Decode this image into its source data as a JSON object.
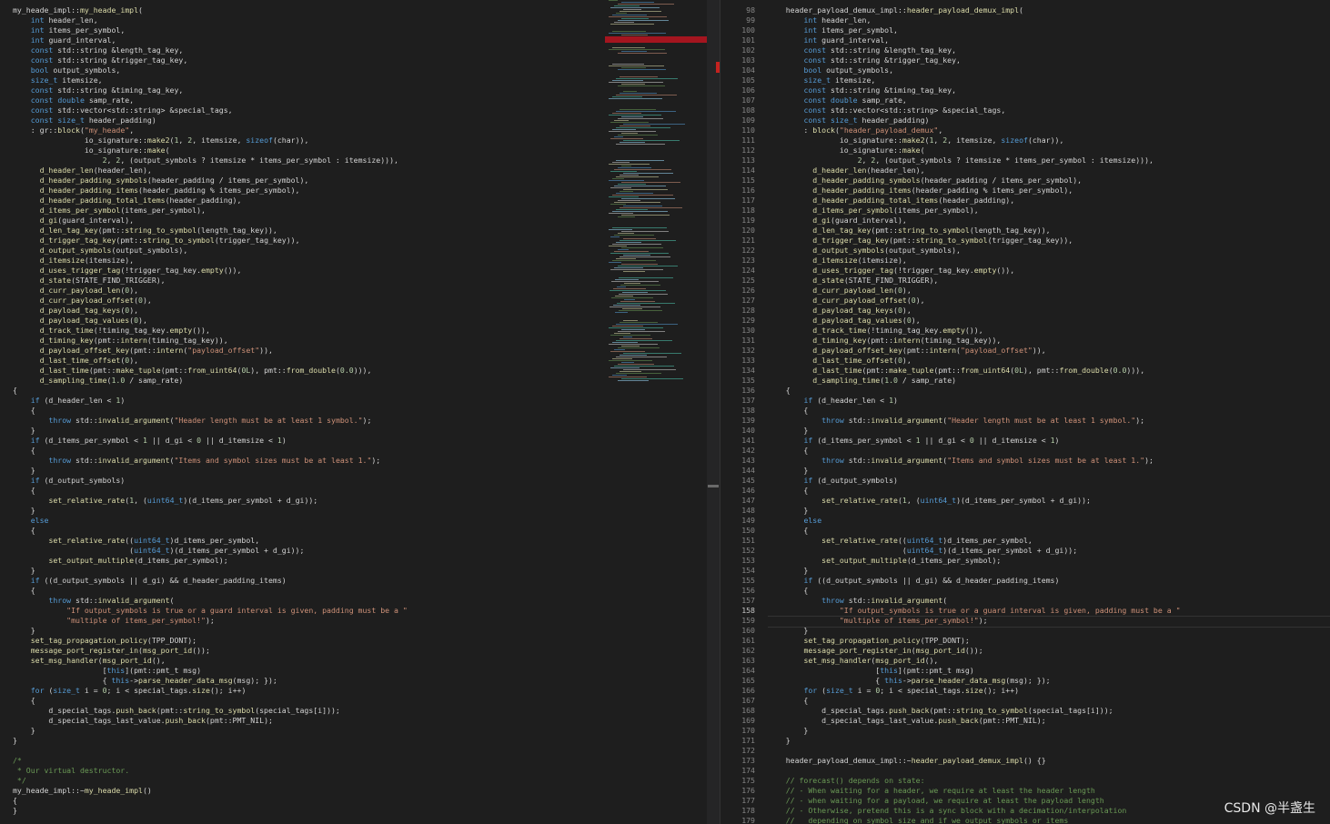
{
  "watermark": "CSDN @半盏生",
  "editor": {
    "active_line": 158,
    "right_start_line": 98
  },
  "left_code": [
    "my_heade_impl::my_heade_impl(",
    "    int header_len,",
    "    int items_per_symbol,",
    "    int guard_interval,",
    "    const std::string &length_tag_key,",
    "    const std::string &trigger_tag_key,",
    "    bool output_symbols,",
    "    size_t itemsize,",
    "    const std::string &timing_tag_key,",
    "    const double samp_rate,",
    "    const std::vector<std::string> &special_tags,",
    "    const size_t header_padding)",
    "    : gr::block(\"my_heade\",",
    "                io_signature::make2(1, 2, itemsize, sizeof(char)),",
    "                io_signature::make(",
    "                    2, 2, (output_symbols ? itemsize * items_per_symbol : itemsize))),",
    "      d_header_len(header_len),",
    "      d_header_padding_symbols(header_padding / items_per_symbol),",
    "      d_header_padding_items(header_padding % items_per_symbol),",
    "      d_header_padding_total_items(header_padding),",
    "      d_items_per_symbol(items_per_symbol),",
    "      d_gi(guard_interval),",
    "      d_len_tag_key(pmt::string_to_symbol(length_tag_key)),",
    "      d_trigger_tag_key(pmt::string_to_symbol(trigger_tag_key)),",
    "      d_output_symbols(output_symbols),",
    "      d_itemsize(itemsize),",
    "      d_uses_trigger_tag(!trigger_tag_key.empty()),",
    "      d_state(STATE_FIND_TRIGGER),",
    "      d_curr_payload_len(0),",
    "      d_curr_payload_offset(0),",
    "      d_payload_tag_keys(0),",
    "      d_payload_tag_values(0),",
    "      d_track_time(!timing_tag_key.empty()),",
    "      d_timing_key(pmt::intern(timing_tag_key)),",
    "      d_payload_offset_key(pmt::intern(\"payload_offset\")),",
    "      d_last_time_offset(0),",
    "      d_last_time(pmt::make_tuple(pmt::from_uint64(0L), pmt::from_double(0.0))),",
    "      d_sampling_time(1.0 / samp_rate)",
    "{",
    "    if (d_header_len < 1)",
    "    {",
    "        throw std::invalid_argument(\"Header length must be at least 1 symbol.\");",
    "    }",
    "    if (d_items_per_symbol < 1 || d_gi < 0 || d_itemsize < 1)",
    "    {",
    "        throw std::invalid_argument(\"Items and symbol sizes must be at least 1.\");",
    "    }",
    "    if (d_output_symbols)",
    "    {",
    "        set_relative_rate(1, (uint64_t)(d_items_per_symbol + d_gi));",
    "    }",
    "    else",
    "    {",
    "        set_relative_rate((uint64_t)d_items_per_symbol,",
    "                          (uint64_t)(d_items_per_symbol + d_gi));",
    "        set_output_multiple(d_items_per_symbol);",
    "    }",
    "    if ((d_output_symbols || d_gi) && d_header_padding_items)",
    "    {",
    "        throw std::invalid_argument(",
    "            \"If output_symbols is true or a guard interval is given, padding must be a \"",
    "            \"multiple of items_per_symbol!\");",
    "    }",
    "    set_tag_propagation_policy(TPP_DONT);",
    "    message_port_register_in(msg_port_id());",
    "    set_msg_handler(msg_port_id(),",
    "                    [this](pmt::pmt_t msg)",
    "                    { this->parse_header_data_msg(msg); });",
    "    for (size_t i = 0; i < special_tags.size(); i++)",
    "    {",
    "        d_special_tags.push_back(pmt::string_to_symbol(special_tags[i]));",
    "        d_special_tags_last_value.push_back(pmt::PMT_NIL);",
    "    }",
    "}",
    "",
    "/*",
    " * Our virtual destructor.",
    " */",
    "my_heade_impl::~my_heade_impl()",
    "{",
    "}"
  ],
  "right_code": [
    "    header_payload_demux_impl::header_payload_demux_impl(",
    "        int header_len,",
    "        int items_per_symbol,",
    "        int guard_interval,",
    "        const std::string &length_tag_key,",
    "        const std::string &trigger_tag_key,",
    "        bool output_symbols,",
    "        size_t itemsize,",
    "        const std::string &timing_tag_key,",
    "        const double samp_rate,",
    "        const std::vector<std::string> &special_tags,",
    "        const size_t header_padding)",
    "        : block(\"header_payload_demux\",",
    "                io_signature::make2(1, 2, itemsize, sizeof(char)),",
    "                io_signature::make(",
    "                    2, 2, (output_symbols ? itemsize * items_per_symbol : itemsize))),",
    "          d_header_len(header_len),",
    "          d_header_padding_symbols(header_padding / items_per_symbol),",
    "          d_header_padding_items(header_padding % items_per_symbol),",
    "          d_header_padding_total_items(header_padding),",
    "          d_items_per_symbol(items_per_symbol),",
    "          d_gi(guard_interval),",
    "          d_len_tag_key(pmt::string_to_symbol(length_tag_key)),",
    "          d_trigger_tag_key(pmt::string_to_symbol(trigger_tag_key)),",
    "          d_output_symbols(output_symbols),",
    "          d_itemsize(itemsize),",
    "          d_uses_trigger_tag(!trigger_tag_key.empty()),",
    "          d_state(STATE_FIND_TRIGGER),",
    "          d_curr_payload_len(0),",
    "          d_curr_payload_offset(0),",
    "          d_payload_tag_keys(0),",
    "          d_payload_tag_values(0),",
    "          d_track_time(!timing_tag_key.empty()),",
    "          d_timing_key(pmt::intern(timing_tag_key)),",
    "          d_payload_offset_key(pmt::intern(\"payload_offset\")),",
    "          d_last_time_offset(0),",
    "          d_last_time(pmt::make_tuple(pmt::from_uint64(0L), pmt::from_double(0.0))),",
    "          d_sampling_time(1.0 / samp_rate)",
    "    {",
    "        if (d_header_len < 1)",
    "        {",
    "            throw std::invalid_argument(\"Header length must be at least 1 symbol.\");",
    "        }",
    "        if (d_items_per_symbol < 1 || d_gi < 0 || d_itemsize < 1)",
    "        {",
    "            throw std::invalid_argument(\"Items and symbol sizes must be at least 1.\");",
    "        }",
    "        if (d_output_symbols)",
    "        {",
    "            set_relative_rate(1, (uint64_t)(d_items_per_symbol + d_gi));",
    "        }",
    "        else",
    "        {",
    "            set_relative_rate((uint64_t)d_items_per_symbol,",
    "                              (uint64_t)(d_items_per_symbol + d_gi));",
    "            set_output_multiple(d_items_per_symbol);",
    "        }",
    "        if ((d_output_symbols || d_gi) && d_header_padding_items)",
    "        {",
    "            throw std::invalid_argument(",
    "                \"If output_symbols is true or a guard interval is given, padding must be a \"",
    "                \"multiple of items_per_symbol!\");",
    "        }",
    "        set_tag_propagation_policy(TPP_DONT);",
    "        message_port_register_in(msg_port_id());",
    "        set_msg_handler(msg_port_id(),",
    "                        [this](pmt::pmt_t msg)",
    "                        { this->parse_header_data_msg(msg); });",
    "        for (size_t i = 0; i < special_tags.size(); i++)",
    "        {",
    "            d_special_tags.push_back(pmt::string_to_symbol(special_tags[i]));",
    "            d_special_tags_last_value.push_back(pmt::PMT_NIL);",
    "        }",
    "    }",
    "",
    "    header_payload_demux_impl::~header_payload_demux_impl() {}",
    "",
    "    // forecast() depends on state:",
    "    // - When waiting for a header, we require at least the header length",
    "    // - when waiting for a payload, we require at least the payload length",
    "    // - Otherwise, pretend this is a sync block with a decimation/interpolation",
    "    //   depending on symbol size and if we output symbols or items"
  ]
}
